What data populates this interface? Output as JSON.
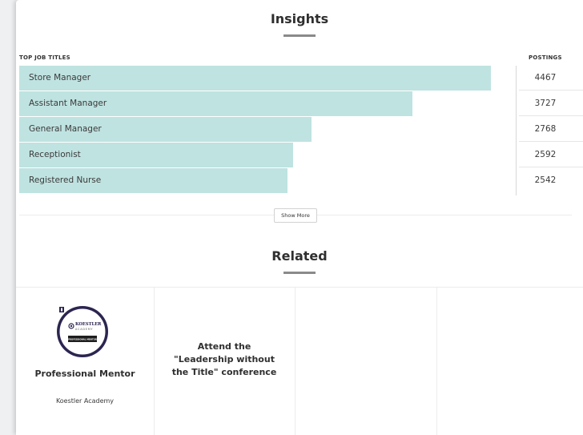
{
  "insights": {
    "title": "Insights",
    "col_job_titles": "TOP JOB TITLES",
    "col_postings": "POSTINGS",
    "rows": [
      {
        "label": "Store Manager",
        "postings": "4467",
        "fraction": 1.0
      },
      {
        "label": "Assistant Manager",
        "postings": "3727",
        "fraction": 0.834
      },
      {
        "label": "General Manager",
        "postings": "2768",
        "fraction": 0.62
      },
      {
        "label": "Receptionist",
        "postings": "2592",
        "fraction": 0.58
      },
      {
        "label": "Registered Nurse",
        "postings": "2542",
        "fraction": 0.569
      }
    ],
    "show_more_label": "Show More",
    "bar_color": "#bfe3e1"
  },
  "related": {
    "title": "Related",
    "cards": [
      {
        "title": "Professional Mentor",
        "subtitle": "Koestler Academy",
        "badge_icon": "koestler-academy-badge-icon",
        "badge_text_top": "KOESTLER",
        "badge_text_mid": "ACADEMY",
        "badge_text_bottom": "PROFESSIONAL MENTOR"
      },
      {
        "title": "Attend the \"Leadership without the Title\" conference",
        "subtitle": ""
      },
      {
        "title": "",
        "subtitle": ""
      },
      {
        "title": "",
        "subtitle": ""
      }
    ]
  }
}
